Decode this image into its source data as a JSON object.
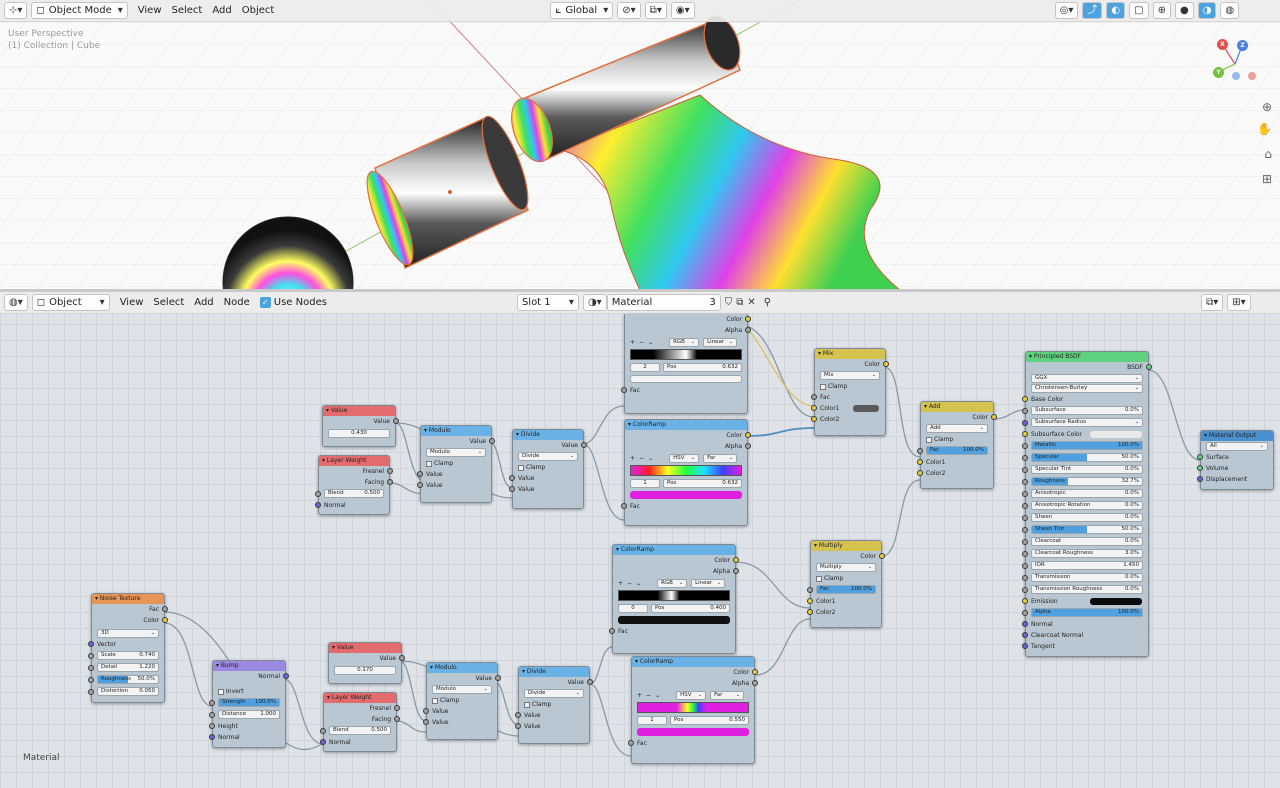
{
  "viewport": {
    "mode": "Object Mode",
    "menu": [
      "View",
      "Select",
      "Add",
      "Object"
    ],
    "orientation": "Global",
    "info_line1": "User Perspective",
    "info_line2": "(1) Collection | Cube",
    "gizmo": {
      "x": "X",
      "y": "Y",
      "z": "Z"
    }
  },
  "editor": {
    "mode": "Object",
    "menu": [
      "View",
      "Select",
      "Add",
      "Node"
    ],
    "use_nodes": "Use Nodes",
    "slot": "Slot 1",
    "material": "Material",
    "users": "3",
    "area_label": "Material"
  },
  "nodes": {
    "value1": {
      "title": "Value",
      "out": "Value",
      "val": "0.430"
    },
    "lw1": {
      "title": "Layer Weight",
      "fresnel": "Fresnel",
      "facing": "Facing",
      "blend_l": "Blend",
      "blend_v": "0.500",
      "normal": "Normal"
    },
    "mod1": {
      "title": "Modulo",
      "out": "Value",
      "op": "Modulo",
      "clamp": "Clamp",
      "in1": "Value",
      "in2": "Value"
    },
    "div1": {
      "title": "Divide",
      "out": "Value",
      "op": "Divide",
      "clamp": "Clamp",
      "in1": "Value",
      "in2": "Value"
    },
    "ramp1": {
      "color": "Color",
      "alpha": "Alpha",
      "mode": "RGB",
      "interp": "Linear",
      "idx": "2",
      "pos_l": "Pos",
      "pos_v": "0.632",
      "fac": "Fac"
    },
    "ramp2": {
      "title": "ColorRamp",
      "color": "Color",
      "alpha": "Alpha",
      "mode": "HSV",
      "interp": "Far",
      "idx": "1",
      "pos_l": "Pos",
      "pos_v": "0.632",
      "fac": "Fac"
    },
    "mix": {
      "title": "Mix",
      "out": "Color",
      "op": "Mix",
      "clamp": "Clamp",
      "fac": "Fac",
      "c1": "Color1",
      "c2": "Color2"
    },
    "add": {
      "title": "Add",
      "out": "Color",
      "op": "Add",
      "clamp": "Clamp",
      "fac_l": "Fac",
      "fac_v": "100.0%",
      "c1": "Color1",
      "c2": "Color2"
    },
    "bsdf": {
      "title": "Principled BSDF",
      "out": "BSDF",
      "dist": "GGX",
      "sss": "Christensen-Burley",
      "rows": [
        {
          "k": "Base Color",
          "t": "sock"
        },
        {
          "k": "Subsurface",
          "v": "0.0%",
          "t": "fld"
        },
        {
          "k": "Subsurface Radius",
          "t": "sel"
        },
        {
          "k": "Subsurface Color",
          "t": "col"
        },
        {
          "k": "Metallic",
          "v": "100.0%",
          "t": "bar",
          "p": "100%"
        },
        {
          "k": "Specular",
          "v": "50.0%",
          "t": "bar",
          "p": "50%"
        },
        {
          "k": "Specular Tint",
          "v": "0.0%",
          "t": "fld"
        },
        {
          "k": "Roughness",
          "v": "32.7%",
          "t": "bar",
          "p": "32.7%"
        },
        {
          "k": "Anisotropic",
          "v": "0.0%",
          "t": "fld"
        },
        {
          "k": "Anisotropic Rotation",
          "v": "0.0%",
          "t": "fld"
        },
        {
          "k": "Sheen",
          "v": "0.0%",
          "t": "fld"
        },
        {
          "k": "Sheen Tint",
          "v": "50.0%",
          "t": "bar",
          "p": "50%"
        },
        {
          "k": "Clearcoat",
          "v": "0.0%",
          "t": "fld"
        },
        {
          "k": "Clearcoat Roughness",
          "v": "3.0%",
          "t": "fld"
        },
        {
          "k": "IOR",
          "v": "1.450",
          "t": "fld"
        },
        {
          "k": "Transmission",
          "v": "0.0%",
          "t": "fld"
        },
        {
          "k": "Transmission Roughness",
          "v": "0.0%",
          "t": "fld"
        },
        {
          "k": "Emission",
          "t": "black"
        },
        {
          "k": "Alpha",
          "v": "100.0%",
          "t": "bar",
          "p": "100%"
        },
        {
          "k": "Normal",
          "t": "sock"
        },
        {
          "k": "Clearcoat Normal",
          "t": "sock"
        },
        {
          "k": "Tangent",
          "t": "sock"
        }
      ]
    },
    "output": {
      "title": "Material Output",
      "target": "All",
      "surface": "Surface",
      "volume": "Volume",
      "displacement": "Displacement"
    },
    "ramp3": {
      "title": "ColorRamp",
      "color": "Color",
      "alpha": "Alpha",
      "mode": "RGB",
      "interp": "Linear",
      "idx": "0",
      "pos_l": "Pos",
      "pos_v": "0.400",
      "fac": "Fac"
    },
    "mult": {
      "title": "Multiply",
      "out": "Color",
      "op": "Multiply",
      "clamp": "Clamp",
      "fac_l": "Fac",
      "fac_v": "100.0%",
      "c1": "Color1",
      "c2": "Color2"
    },
    "noise": {
      "title": "Noise Texture",
      "fac": "Fac",
      "color": "Color",
      "dim": "3D",
      "vector": "Vector",
      "scale_l": "Scale",
      "scale_v": "0.740",
      "detail_l": "Detail",
      "detail_v": "1.220",
      "rough_l": "Roughness",
      "rough_v": "50.0%",
      "dist_l": "Distortion",
      "dist_v": "0.050"
    },
    "bump": {
      "title": "Bump",
      "out": "Normal",
      "invert": "Invert",
      "str_l": "Strength",
      "str_v": "100.0%",
      "dist_l": "Distance",
      "dist_v": "1.000",
      "height": "Height",
      "normal": "Normal"
    },
    "value2": {
      "title": "Value",
      "out": "Value",
      "val": "0.170"
    },
    "lw2": {
      "title": "Layer Weight",
      "fresnel": "Fresnel",
      "facing": "Facing",
      "blend_l": "Blend",
      "blend_v": "0.500",
      "normal": "Normal"
    },
    "mod2": {
      "title": "Modulo",
      "out": "Value",
      "op": "Modulo",
      "clamp": "Clamp",
      "in1": "Value",
      "in2": "Value"
    },
    "div2": {
      "title": "Divide",
      "out": "Value",
      "op": "Divide",
      "clamp": "Clamp",
      "in1": "Value",
      "in2": "Value"
    },
    "ramp4": {
      "title": "ColorRamp",
      "color": "Color",
      "alpha": "Alpha",
      "mode": "HSV",
      "interp": "Far",
      "idx": "1",
      "pos_l": "Pos",
      "pos_v": "0.550",
      "fac": "Fac"
    }
  }
}
